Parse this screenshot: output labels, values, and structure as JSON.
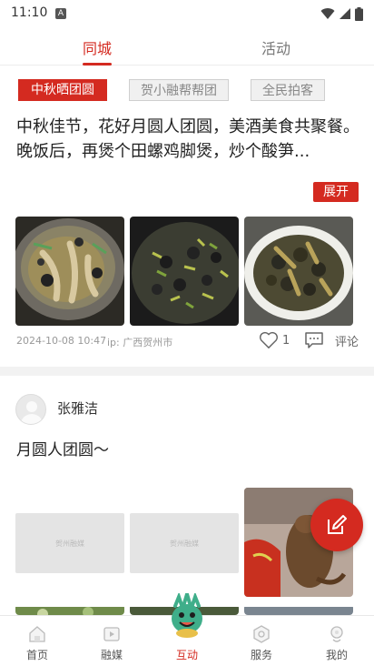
{
  "status": {
    "time": "11:10",
    "notification_badge": "A"
  },
  "top_tabs": [
    {
      "label": "同城",
      "active": true
    },
    {
      "label": "活动",
      "active": false
    }
  ],
  "chips": [
    {
      "label": "中秋晒团圆",
      "active": true
    },
    {
      "label": "贺小融帮帮团",
      "active": false
    },
    {
      "label": "全民拍客",
      "active": false
    }
  ],
  "post1": {
    "text": "中秋佳节，花好月圆人团圆，美酒美食共聚餐。晚饭后，再煲个田螺鸡脚煲，炒个酸笋...",
    "expand_label": "展开",
    "timestamp": "2024-10-08 10:47",
    "location": "ip: 广西贺州市",
    "like_count": "1",
    "comment_label": "评论"
  },
  "post2": {
    "username": "张雅洁",
    "text": "月圆人团圆～",
    "placeholder_text": "贺州融媒"
  },
  "bottom_nav": [
    {
      "label": "首页",
      "icon": "home-icon",
      "active": false
    },
    {
      "label": "融媒",
      "icon": "media-icon",
      "active": false
    },
    {
      "label": "互动",
      "icon": "mascot-icon",
      "active": true
    },
    {
      "label": "服务",
      "icon": "service-icon",
      "active": false
    },
    {
      "label": "我的",
      "icon": "profile-icon",
      "active": false
    }
  ],
  "colors": {
    "accent": "#d42a20",
    "muted": "#999999",
    "divider": "#f2f2f2"
  }
}
